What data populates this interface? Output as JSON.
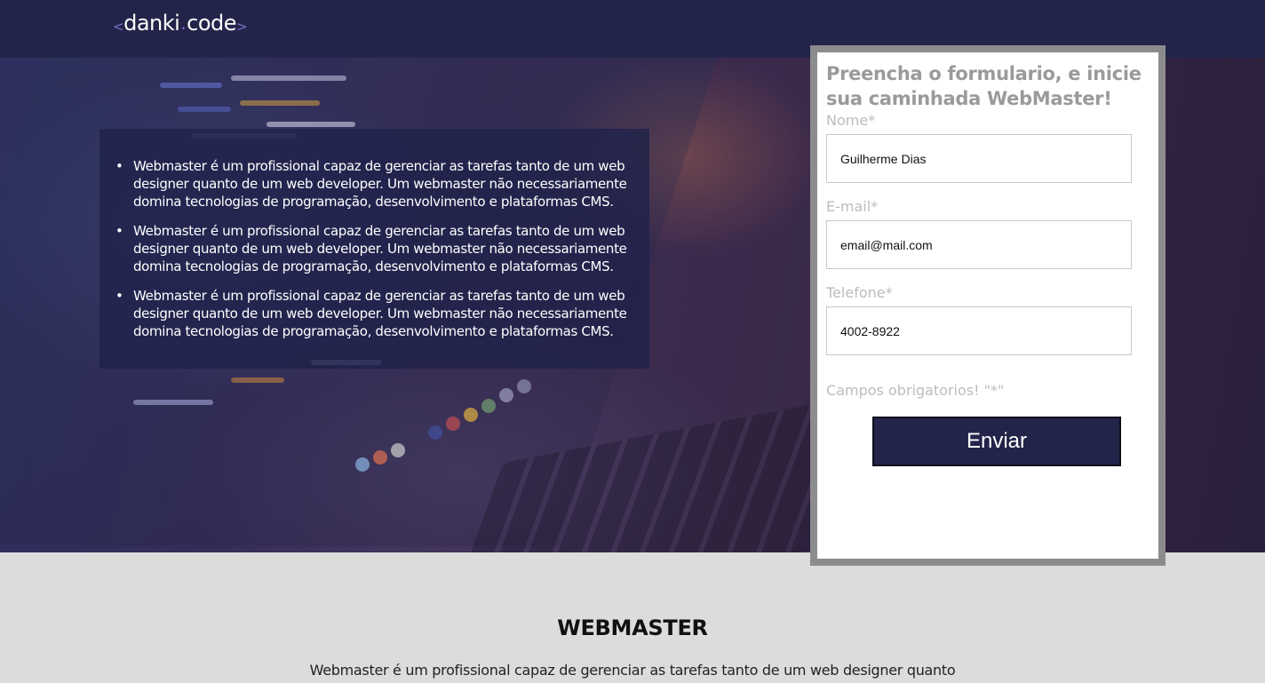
{
  "header": {
    "logo": {
      "left_bracket": "<",
      "word1": "danki",
      "dot": ".",
      "word2": "code",
      "right_bracket": ">"
    }
  },
  "hero": {
    "items": [
      {
        "text": "Webmaster é um profissional capaz de gerenciar as tarefas tanto de um web designer quanto de um web developer. Um webmaster não necessariamente domina tecnologias de programação, desenvolvimento e plataformas CMS."
      },
      {
        "text": "Webmaster é um profissional capaz de gerenciar as tarefas tanto de um web designer quanto de um web developer. Um webmaster não necessariamente domina tecnologias de programação, desenvolvimento e plataformas CMS."
      },
      {
        "text": "Webmaster é um profissional capaz de gerenciar as tarefas tanto de um web designer quanto de um web developer. Um webmaster não necessariamente domina tecnologias de programação, desenvolvimento e plataformas CMS."
      }
    ]
  },
  "form": {
    "title": "Preencha o formulario, e inicie sua caminhada WebMaster!",
    "fields": {
      "name": {
        "label": "Nome*",
        "value": "Guilherme Dias"
      },
      "email": {
        "label": "E-mail*",
        "value": "email@mail.com"
      },
      "phone": {
        "label": "Telefone*",
        "value": "4002-8922"
      }
    },
    "required_note": "Campos obrigatorios! \"*\"",
    "submit_label": "Enviar"
  },
  "section": {
    "title": "WEBMASTER",
    "text": "Webmaster é um profissional capaz de gerenciar as tarefas tanto de um web designer quanto"
  },
  "colors": {
    "header_bg": "#23244a",
    "accent": "#7a6fc9",
    "button_bg": "#23244a",
    "panel_border": "#8c8c8f",
    "section_bg": "#dcdcdc"
  }
}
